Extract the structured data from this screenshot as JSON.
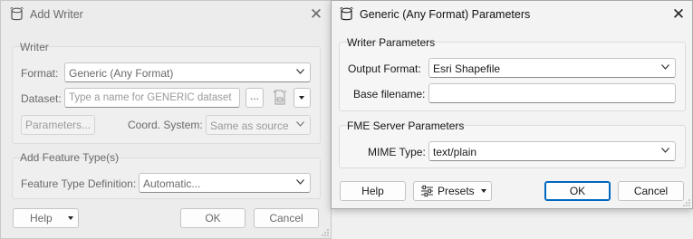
{
  "add_writer": {
    "title": "Add Writer",
    "writer_group": {
      "title": "Writer",
      "format_label": "Format:",
      "format_value": "Generic (Any Format)",
      "dataset_label": "Dataset:",
      "dataset_placeholder": "Type a name for GENERIC dataset",
      "browse_label": "...",
      "parameters_label": "Parameters...",
      "coord_label": "Coord. System:",
      "coord_value": "Same as source"
    },
    "feature_group": {
      "title": "Add Feature Type(s)",
      "definition_label": "Feature Type Definition:",
      "definition_value": "Automatic..."
    },
    "buttons": {
      "help": "Help",
      "ok": "OK",
      "cancel": "Cancel"
    }
  },
  "generic_params": {
    "title": "Generic (Any Format) Parameters",
    "writer_params": {
      "title": "Writer Parameters",
      "output_format_label": "Output Format:",
      "output_format_value": "Esri Shapefile",
      "base_filename_label": "Base filename:",
      "base_filename_value": ""
    },
    "server_params": {
      "title": "FME Server Parameters",
      "mime_label": "MIME Type:",
      "mime_value": "text/plain"
    },
    "buttons": {
      "help": "Help",
      "presets": "Presets",
      "ok": "OK",
      "cancel": "Cancel"
    }
  },
  "icons": [
    "database-icon",
    "close-icon",
    "chevron-down-icon",
    "dropdown-arrow-icon",
    "dataset-file-icon",
    "presets-sliders-icon",
    "resize-grip-icon"
  ],
  "colors": {
    "accent": "#0067c0",
    "disabled_text": "#9a9a9a"
  }
}
